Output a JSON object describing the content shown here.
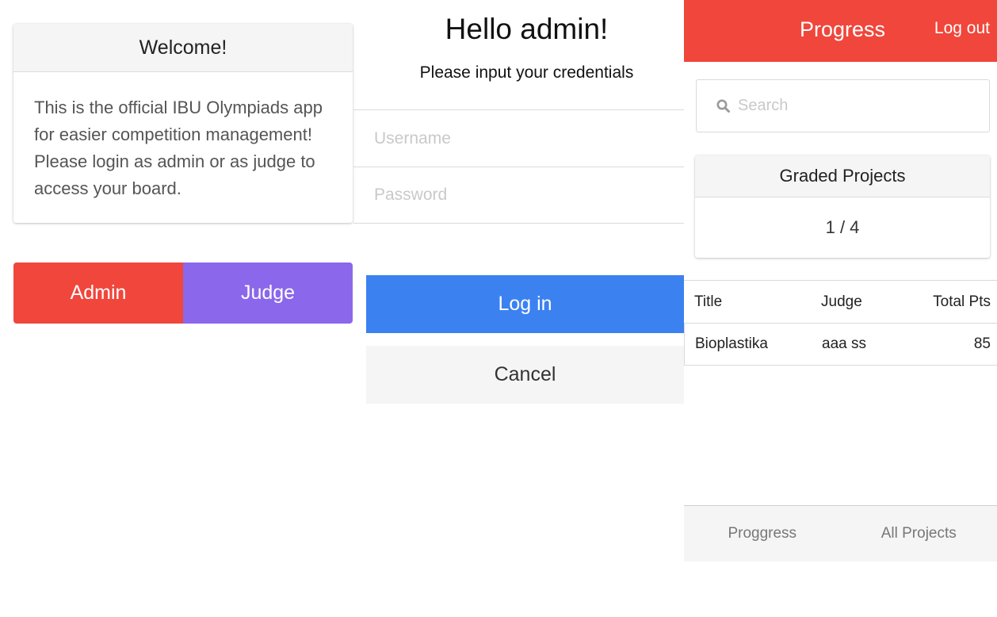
{
  "welcome": {
    "title": "Welcome!",
    "line1": "This is the official IBU Olympiads app",
    "line2": "for easier competition management!",
    "line3": "Please login as admin or as judge to",
    "line4": "access your board."
  },
  "roles": {
    "admin": "Admin",
    "judge": "Judge"
  },
  "login": {
    "greeting": "Hello admin!",
    "subtitle": "Please input your credentials",
    "username_placeholder": "Username",
    "password_placeholder": "Password",
    "login_label": "Log in",
    "cancel_label": "Cancel"
  },
  "progress": {
    "header_title": "Progress",
    "logout_label": "Log out",
    "search_placeholder": "Search",
    "graded_title": "Graded Projects",
    "graded_value": "1 / 4",
    "table": {
      "headers": [
        "Title",
        "Judge",
        "Total Pts"
      ],
      "rows": [
        [
          "Bioplastika",
          "aaa ss",
          "85"
        ]
      ]
    },
    "nav": {
      "tab1": "Proggress",
      "tab2": "All Projects"
    }
  },
  "colors": {
    "red": "#f0463b",
    "purple": "#8b67eb",
    "blue": "#3b82f0",
    "light_gray": "#f5f5f5"
  },
  "icons": {
    "search": "search-icon"
  }
}
